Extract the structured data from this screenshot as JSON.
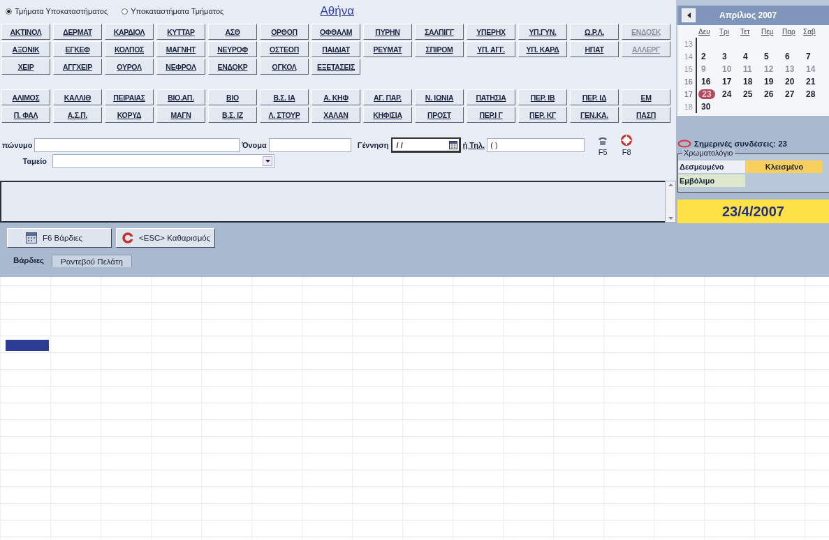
{
  "mode_options": [
    {
      "label": "Τμήματα Υποκαταστήματος",
      "selected": true
    },
    {
      "label": "Υποκαταστήματα Τμήματος",
      "selected": false
    }
  ],
  "city_link": "Αθήνα",
  "department_buttons": [
    [
      {
        "label": "ΑΚΤΙΝΟΛ",
        "disabled": false
      },
      {
        "label": "ΔΕΡΜΑΤ",
        "disabled": false
      },
      {
        "label": "ΚΑΡΔΙΟΛ",
        "disabled": false
      },
      {
        "label": "ΚΥΤΤΑΡ",
        "disabled": false
      },
      {
        "label": "ΑΣΘ",
        "disabled": false
      },
      {
        "label": "ΟΡΘΟΠ",
        "disabled": false
      },
      {
        "label": "ΟΦΘΑΛΜ",
        "disabled": false
      },
      {
        "label": "ΠΥΡΗΝ",
        "disabled": false
      },
      {
        "label": "ΣΑΛΠΙΓΓ",
        "disabled": false
      },
      {
        "label": "ΥΠΕΡΗΧ",
        "disabled": false
      },
      {
        "label": "ΥΠ.ΓΥΝ.",
        "disabled": false
      },
      {
        "label": "Ω.Ρ.Λ.",
        "disabled": false
      },
      {
        "label": "ΕΝΔΟΣΚ",
        "disabled": true
      }
    ],
    [
      {
        "label": "ΑΞΟΝΙΚ",
        "disabled": false
      },
      {
        "label": "ΕΓΚΕΦ",
        "disabled": false
      },
      {
        "label": "ΚΟΛΠΟΣ",
        "disabled": false
      },
      {
        "label": "ΜΑΓΝΗΤ",
        "disabled": false
      },
      {
        "label": "ΝΕΥΡΟΦ",
        "disabled": false
      },
      {
        "label": "ΟΣΤΕΟΠ",
        "disabled": false
      },
      {
        "label": "ΠΑΙΔΙΑΤ",
        "disabled": false
      },
      {
        "label": "ΡΕΥΜΑΤ",
        "disabled": false
      },
      {
        "label": "ΣΠΙΡΟΜ",
        "disabled": false
      },
      {
        "label": "ΥΠ. ΑΓΓ.",
        "disabled": false
      },
      {
        "label": "ΥΠ. ΚΑΡΔ",
        "disabled": false
      },
      {
        "label": "ΗΠΑΤ",
        "disabled": false
      },
      {
        "label": "ΑΛΛΕΡΓ",
        "disabled": true
      }
    ],
    [
      {
        "label": "ΧΕΙΡ",
        "disabled": false
      },
      {
        "label": "ΑΓΓΧΕΙΡ",
        "disabled": false
      },
      {
        "label": "ΟΥΡΟΛ",
        "disabled": false
      },
      {
        "label": "ΝΕΦΡΟΛ",
        "disabled": false
      },
      {
        "label": "ΕΝΔΟΚΡ",
        "disabled": false
      },
      {
        "label": "ΟΓΚΟΛ",
        "disabled": false
      },
      {
        "label": "ΕΞΕΤΑΣΕΙΣ",
        "disabled": false
      }
    ]
  ],
  "branch_buttons": [
    [
      {
        "label": "ΑΛΙΜΟΣ",
        "disabled": false
      },
      {
        "label": "ΚΑΛΛΙΘ",
        "disabled": false
      },
      {
        "label": "ΠΕΙΡΑΙΑΣ",
        "disabled": false
      },
      {
        "label": "ΒΙΟ.ΑΠ.",
        "disabled": false
      },
      {
        "label": "ΒΙΟ",
        "disabled": false
      },
      {
        "label": "Β.Σ. ΙΑ",
        "disabled": false
      },
      {
        "label": "Α. ΚΗΦ",
        "disabled": false
      },
      {
        "label": "ΑΓ. ΠΑΡ.",
        "disabled": false
      },
      {
        "label": "Ν. ΙΩΝΙΑ",
        "disabled": false
      },
      {
        "label": "ΠΑΤΗΣΙΑ",
        "disabled": false
      },
      {
        "label": "ΠΕΡ. ΙΒ",
        "disabled": false
      },
      {
        "label": "ΠΕΡ. ΙΔ",
        "disabled": false
      },
      {
        "label": "ΕΜ",
        "disabled": false
      }
    ],
    [
      {
        "label": "Π. ΦΑΛ",
        "disabled": false
      },
      {
        "label": "Α.Σ.Π.",
        "disabled": false
      },
      {
        "label": "ΚΟΡΥΔ",
        "disabled": false
      },
      {
        "label": "ΜΑΓΝ",
        "disabled": false
      },
      {
        "label": "Β.Σ. ΙΖ",
        "disabled": false
      },
      {
        "label": "Λ. ΣΤΟΥΡ",
        "disabled": false
      },
      {
        "label": "ΧΑΛΑΝ",
        "disabled": false
      },
      {
        "label": "ΚΗΦΙΣΙΑ",
        "disabled": false
      },
      {
        "label": "ΠΡΟΣΤ",
        "disabled": false
      },
      {
        "label": "ΠΕΡ.Ι Γ",
        "disabled": false
      },
      {
        "label": "ΠΕΡ. ΚΓ",
        "disabled": false
      },
      {
        "label": "ΓΕΝ.ΚΑ.",
        "disabled": false
      },
      {
        "label": "ΠΑΣΠ",
        "disabled": false
      }
    ]
  ],
  "form": {
    "surname_label": "πώνυμο",
    "name_label": "Όνομα",
    "birth_label": "Γέννηση",
    "birth_value": "/ /",
    "phone_label": "ή Τηλ.",
    "phone_value": "( )",
    "fund_label": "Ταμείο"
  },
  "shortcuts": [
    {
      "key": "F5",
      "kind": "phone"
    },
    {
      "key": "F8",
      "kind": "lifebuoy"
    }
  ],
  "actions": [
    {
      "label": "F6 Βάρδιες",
      "kind": "calendar"
    },
    {
      "label": "<ESC> Καθαρισμός",
      "kind": "clear"
    }
  ],
  "tabs": [
    {
      "label": "Βάρδιες",
      "selected": true
    },
    {
      "label": "Ραντεβού Πελάτη",
      "selected": false
    }
  ],
  "calendar": {
    "title": "Απρίλιος 2007",
    "weekdays": [
      "Δευ",
      "Τρι",
      "Τετ",
      "Πεμ",
      "Παρ",
      "Σαβ"
    ],
    "weeks": [
      {
        "number": "13",
        "dim": true
      },
      {
        "number": "14",
        "dim": true,
        "days": [
          {
            "day": "2",
            "dim": false,
            "today": false
          },
          {
            "day": "3",
            "dim": false,
            "today": false
          },
          {
            "day": "4",
            "dim": false,
            "today": false
          },
          {
            "day": "5",
            "dim": false,
            "today": false
          },
          {
            "day": "6",
            "dim": false,
            "today": false
          },
          {
            "day": "7",
            "dim": false,
            "today": false
          }
        ]
      },
      {
        "number": "15",
        "dim": true,
        "days": [
          {
            "day": "9",
            "dim": true,
            "today": false
          },
          {
            "day": "10",
            "dim": true,
            "today": false
          },
          {
            "day": "11",
            "dim": true,
            "today": false
          },
          {
            "day": "12",
            "dim": true,
            "today": false
          },
          {
            "day": "13",
            "dim": true,
            "today": false
          },
          {
            "day": "14",
            "dim": true,
            "today": false
          }
        ]
      },
      {
        "number": "16",
        "dim": false,
        "days": [
          {
            "day": "16",
            "dim": false,
            "today": false
          },
          {
            "day": "17",
            "dim": false,
            "today": false
          },
          {
            "day": "18",
            "dim": false,
            "today": false
          },
          {
            "day": "19",
            "dim": false,
            "today": false
          },
          {
            "day": "20",
            "dim": false,
            "today": false
          },
          {
            "day": "21",
            "dim": false,
            "today": false
          }
        ]
      },
      {
        "number": "17",
        "dim": false,
        "days": [
          {
            "day": "23",
            "dim": false,
            "today": true
          },
          {
            "day": "24",
            "dim": false,
            "today": false
          },
          {
            "day": "25",
            "dim": false,
            "today": false
          },
          {
            "day": "26",
            "dim": false,
            "today": false
          },
          {
            "day": "27",
            "dim": false,
            "today": false
          },
          {
            "day": "28",
            "dim": false,
            "today": false
          }
        ]
      },
      {
        "number": "18",
        "dim": true,
        "days": [
          {
            "day": "30",
            "dim": false,
            "today": false
          }
        ]
      }
    ]
  },
  "connections": "Σημερινές συνδέσεις: 23",
  "legend": {
    "title": "Χρωματολόγιο",
    "items": [
      {
        "label": "Δεσμευμένο",
        "color": "#eceff4"
      },
      {
        "label": "Κλεισμένο",
        "color": "#f8cf5a"
      },
      {
        "label": "Εμβόλιμο",
        "color": "#dde8cc"
      }
    ]
  },
  "current_date": "23/4/2007"
}
